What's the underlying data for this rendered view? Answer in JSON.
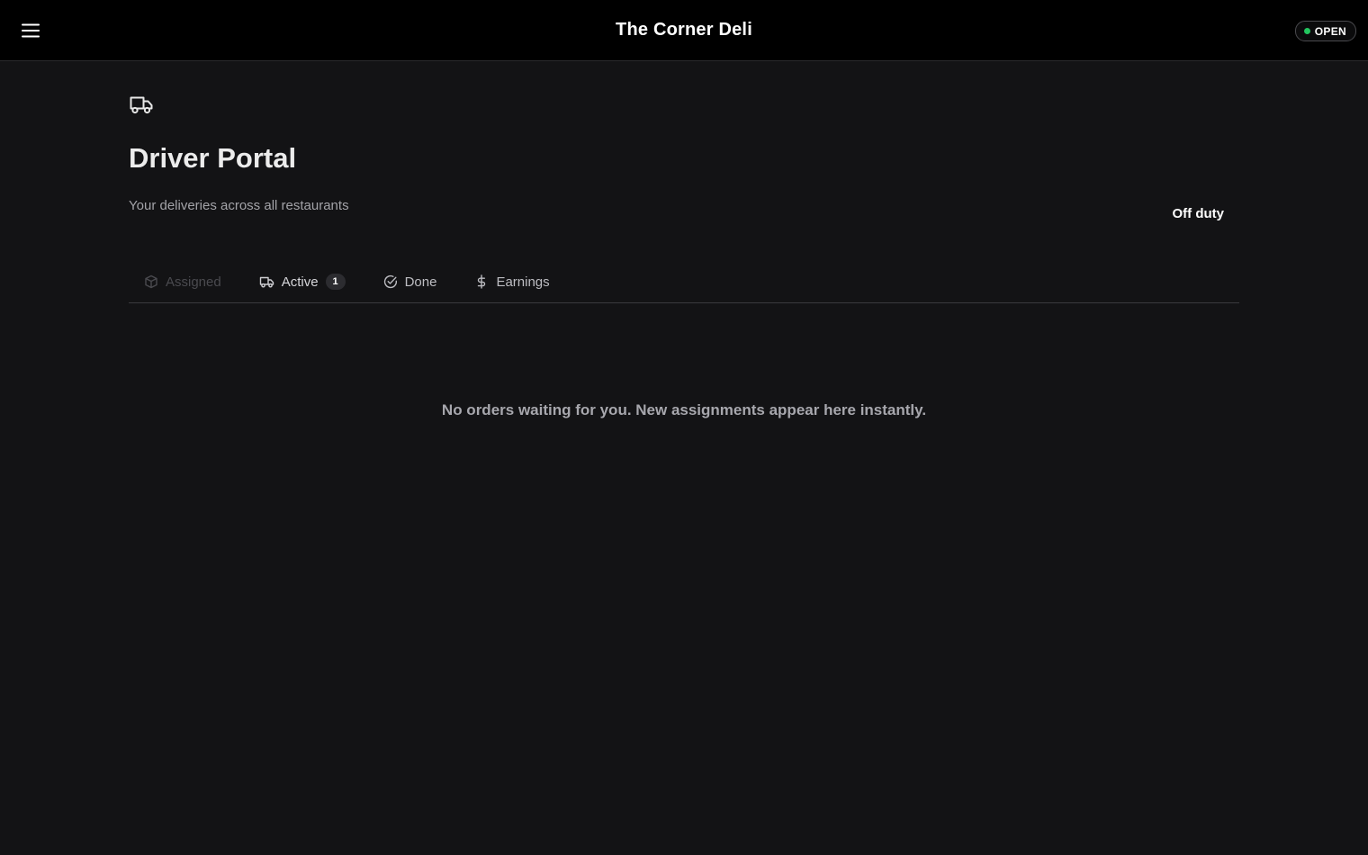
{
  "header": {
    "title": "The Corner Deli",
    "menu_icon": "hamburger-menu-icon",
    "status_label": "OPEN",
    "status_color": "#22c55e"
  },
  "main": {
    "hero_icon": "truck-icon",
    "title": "Driver Portal",
    "subtitle": "Your deliveries across all restaurants",
    "duty_toggle_label": "Off duty",
    "tabs": [
      {
        "label": "Assigned",
        "icon": "package-icon",
        "state": "disabled"
      },
      {
        "label": "Active",
        "icon": "truck-icon",
        "badge": "1",
        "state": "enabled"
      },
      {
        "label": "Done",
        "icon": "check-circle-icon",
        "state": "enabled"
      },
      {
        "label": "Earnings",
        "icon": "dollar-icon",
        "state": "enabled"
      }
    ],
    "empty_message": "No orders waiting for you. New assignments appear here instantly."
  }
}
